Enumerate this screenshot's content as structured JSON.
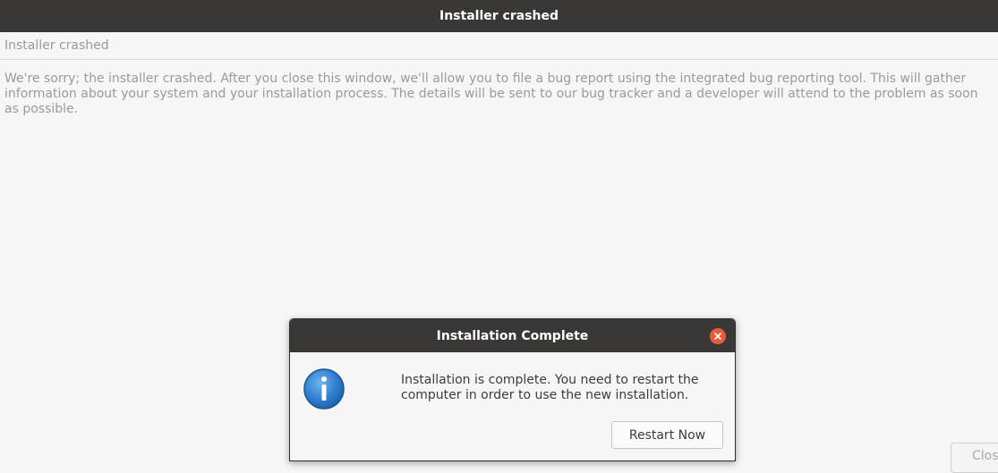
{
  "main_window": {
    "title": "Installer crashed",
    "subheader": "Installer crashed",
    "message": "We're sorry; the installer crashed. After you close this window, we'll allow you to file a bug report using the integrated bug reporting tool. This will gather information about your system and your installation process. The details will be sent to our bug tracker and a developer will attend to the problem as soon as possible.",
    "close_button_label": "Close"
  },
  "dialog": {
    "title": "Installation Complete",
    "icon": "info-icon",
    "message": "Installation is complete. You need to restart the computer in order to use the new installation.",
    "restart_button_label": "Restart Now",
    "close_icon": "close-icon"
  },
  "colors": {
    "titlebar": "#3a3836",
    "close_accent": "#e35d3a",
    "info_blue": "#2f7fcf",
    "background": "#f6f6f6"
  }
}
